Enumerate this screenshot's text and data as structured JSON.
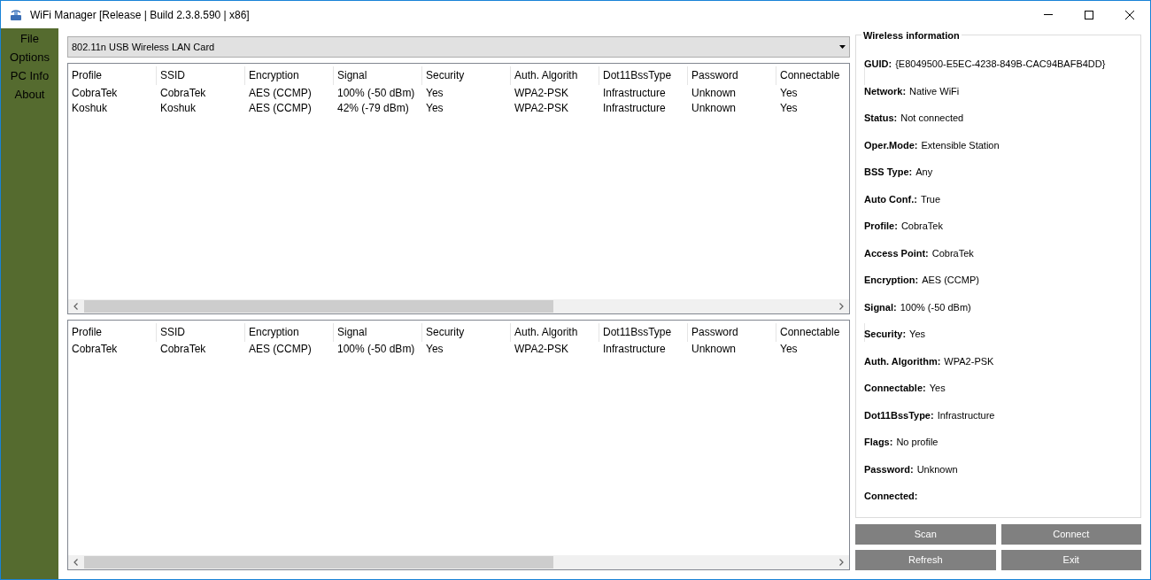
{
  "window": {
    "title": "WiFi Manager [Release | Build 2.3.8.590 | x86]"
  },
  "sidebar": {
    "items": [
      "File",
      "Options",
      "PC Info",
      "About"
    ]
  },
  "adapter_dropdown": {
    "value": "802.11n USB Wireless LAN Card"
  },
  "networks_table": {
    "columns": [
      "Profile",
      "SSID",
      "Encryption",
      "Signal",
      "Security",
      "Auth. Algorith",
      "Dot11BssType",
      "Password",
      "Connectable"
    ],
    "rows": [
      [
        "CobraTek",
        "CobraTek",
        "AES (CCMP)",
        "100% (-50 dBm)",
        "Yes",
        "WPA2-PSK",
        "Infrastructure",
        "Unknown",
        "Yes"
      ],
      [
        "Koshuk",
        "Koshuk",
        "AES (CCMP)",
        "42% (-79 dBm)",
        "Yes",
        "WPA2-PSK",
        "Infrastructure",
        "Unknown",
        "Yes"
      ]
    ]
  },
  "profiles_table": {
    "columns": [
      "Profile",
      "SSID",
      "Encryption",
      "Signal",
      "Security",
      "Auth. Algorith",
      "Dot11BssType",
      "Password",
      "Connectable"
    ],
    "rows": [
      [
        "CobraTek",
        "CobraTek",
        "AES (CCMP)",
        "100% (-50 dBm)",
        "Yes",
        "WPA2-PSK",
        "Infrastructure",
        "Unknown",
        "Yes"
      ]
    ]
  },
  "wireless_info": {
    "title": "Wireless information",
    "fields": [
      {
        "label": "GUID:",
        "value": "{E8049500-E5EC-4238-849B-CAC94BAFB4DD}"
      },
      {
        "label": "Network:",
        "value": "Native WiFi"
      },
      {
        "label": "Status:",
        "value": "Not connected"
      },
      {
        "label": "Oper.Mode:",
        "value": "Extensible Station"
      },
      {
        "label": "BSS Type:",
        "value": "Any"
      },
      {
        "label": "Auto Conf.:",
        "value": "True"
      },
      {
        "label": "Profile:",
        "value": "CobraTek"
      },
      {
        "label": "Access Point:",
        "value": "CobraTek"
      },
      {
        "label": "Encryption:",
        "value": "AES (CCMP)"
      },
      {
        "label": "Signal:",
        "value": "100% (-50 dBm)"
      },
      {
        "label": "Security:",
        "value": "Yes"
      },
      {
        "label": "Auth. Algorithm:",
        "value": "WPA2-PSK"
      },
      {
        "label": "Connectable:",
        "value": "Yes"
      },
      {
        "label": "Dot11BssType:",
        "value": "Infrastructure"
      },
      {
        "label": "Flags:",
        "value": "No profile"
      },
      {
        "label": "Password:",
        "value": "Unknown"
      },
      {
        "label": "Connected:"
      }
    ]
  },
  "buttons": [
    "Scan",
    "Connect",
    "Refresh",
    "Exit"
  ]
}
